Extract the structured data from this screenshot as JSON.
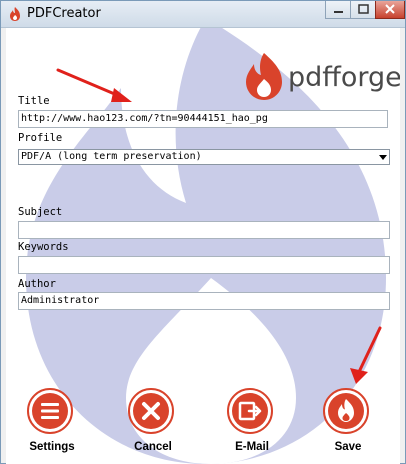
{
  "window": {
    "title": "PDFCreator"
  },
  "logo": {
    "text": "pdfforge"
  },
  "form": {
    "title_label": "Title",
    "title_value": "http://www.hao123.com/?tn=90444151_hao_pg",
    "profile_label": "Profile",
    "profile_value": "PDF/A (long term preservation)",
    "subject_label": "Subject",
    "subject_value": "",
    "keywords_label": "Keywords",
    "keywords_value": "",
    "author_label": "Author",
    "author_value": "Administrator"
  },
  "actions": {
    "settings": "Settings",
    "cancel": "Cancel",
    "email": "E-Mail",
    "save": "Save"
  },
  "colors": {
    "accent": "#d9432b",
    "watermark": "#c9cce8",
    "annotation_arrow": "#e0211b"
  }
}
